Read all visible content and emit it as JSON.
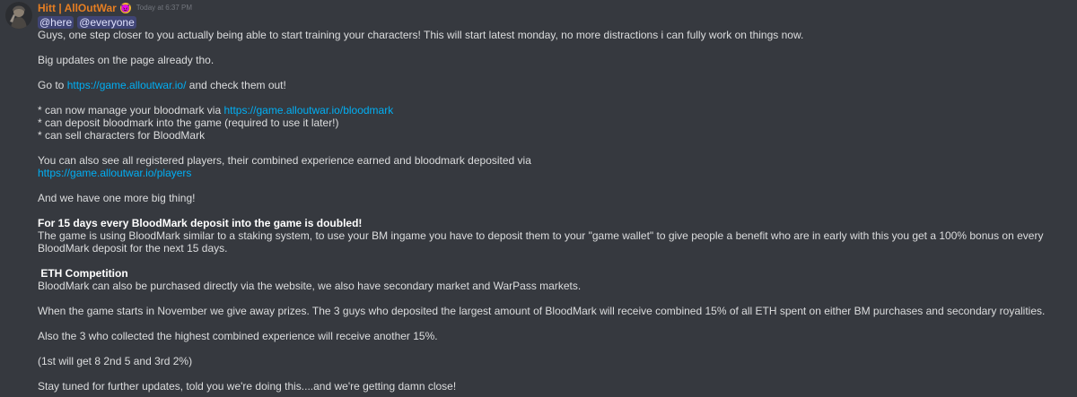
{
  "author": {
    "name": "Hitt | AllOutWar",
    "badge": "😈",
    "timestamp": "Today at 6:37 PM"
  },
  "mentions": [
    "@here",
    "@everyone"
  ],
  "lines": {
    "l1": "Guys, one step closer to you actually being able to start training your characters! This will start latest monday, no more distractions i can fully work on things now.",
    "l2": "Big updates on the page already tho.",
    "l3_pre": "Go to ",
    "l3_link": "https://game.alloutwar.io/",
    "l3_post": " and check them out!",
    "l4_pre": "* can now manage your bloodmark via ",
    "l4_link": "https://game.alloutwar.io/bloodmark",
    "l5": "* can deposit bloodmark into the game (required to use it later!)",
    "l6": "* can sell characters for BloodMark",
    "l7": "You can also see all registered players, their combined experience earned and bloodmark deposited via",
    "l8_link": "https://game.alloutwar.io/players",
    "l9": "And we have one more big thing!",
    "l10_bold": "For 15 days every BloodMark deposit into the game is doubled!",
    "l11": "The game is using BloodMark similar to a staking system, to use your BM ingame you have to deposit them to your \"game wallet\" to give people a benefit who are in early with this you get a 100% bonus on every BloodMark deposit for the next 15 days.",
    "l12_bold": " ETH Competition",
    "l13": "BloodMark can also be purchased directly via the website, we also have secondary market and WarPass markets.",
    "l14": "When the game starts in November we give away prizes. The 3 guys who deposited the largest amount of BloodMark will receive combined 15% of all ETH spent on either BM purchases and secondary royalities.",
    "l15": "Also the 3 who collected the highest combined experience will receive another 15%.",
    "l16": "(1st will get 8 2nd 5 and 3rd 2%)",
    "l17": "Stay tuned for further updates, told you we're doing this....and we're getting damn close!"
  }
}
